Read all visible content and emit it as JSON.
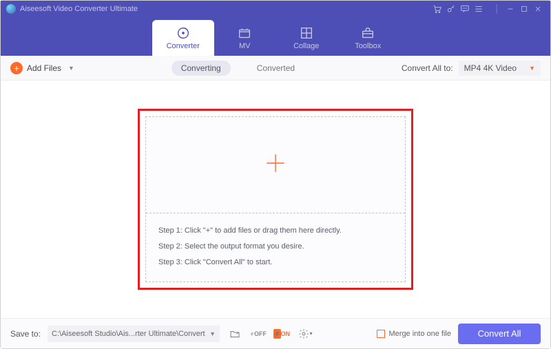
{
  "title": "Aiseesoft Video Converter Ultimate",
  "window_icons": {
    "cart": "cart-icon",
    "key": "key-icon",
    "feedback": "speech-bubble-icon",
    "menu": "menu-icon",
    "minimize": "minimize-icon",
    "maximize": "maximize-icon",
    "close": "close-icon"
  },
  "tabs": [
    {
      "id": "converter",
      "label": "Converter",
      "active": true
    },
    {
      "id": "mv",
      "label": "MV",
      "active": false
    },
    {
      "id": "collage",
      "label": "Collage",
      "active": false
    },
    {
      "id": "toolbox",
      "label": "Toolbox",
      "active": false
    }
  ],
  "toolbar": {
    "add_label": "Add Files",
    "subtabs": [
      {
        "id": "converting",
        "label": "Converting",
        "active": true
      },
      {
        "id": "converted",
        "label": "Converted",
        "active": false
      }
    ],
    "convert_all_label": "Convert All to:",
    "output_format": "MP4 4K Video"
  },
  "dropzone": {
    "step1": "Step 1: Click \"+\" to add files or drag them here directly.",
    "step2": "Step 2: Select the output format you desire.",
    "step3": "Step 3: Click \"Convert All\" to start."
  },
  "footer": {
    "save_label": "Save to:",
    "save_path": "C:\\Aiseesoft Studio\\Ais...rter Ultimate\\Converted",
    "merge_label": "Merge into one file",
    "convert_button": "Convert All"
  }
}
